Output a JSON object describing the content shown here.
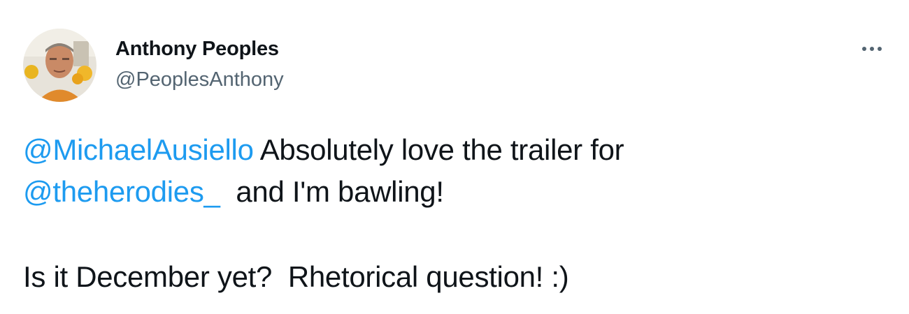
{
  "author": {
    "display_name": "Anthony Peoples",
    "handle": "@PeoplesAnthony"
  },
  "colors": {
    "text": "#0f1419",
    "secondary": "#536471",
    "link": "#1d9bf0"
  },
  "icons": {
    "more": "more-horizontal-icon"
  },
  "tweet": {
    "mention_1": "@MichaelAusiello",
    "text_1": " Absolutely love the trailer for",
    "mention_2": "@theherodies_",
    "text_2": "  and I'm bawling!",
    "text_3": "Is it December yet?  Rhetorical question! :)"
  }
}
